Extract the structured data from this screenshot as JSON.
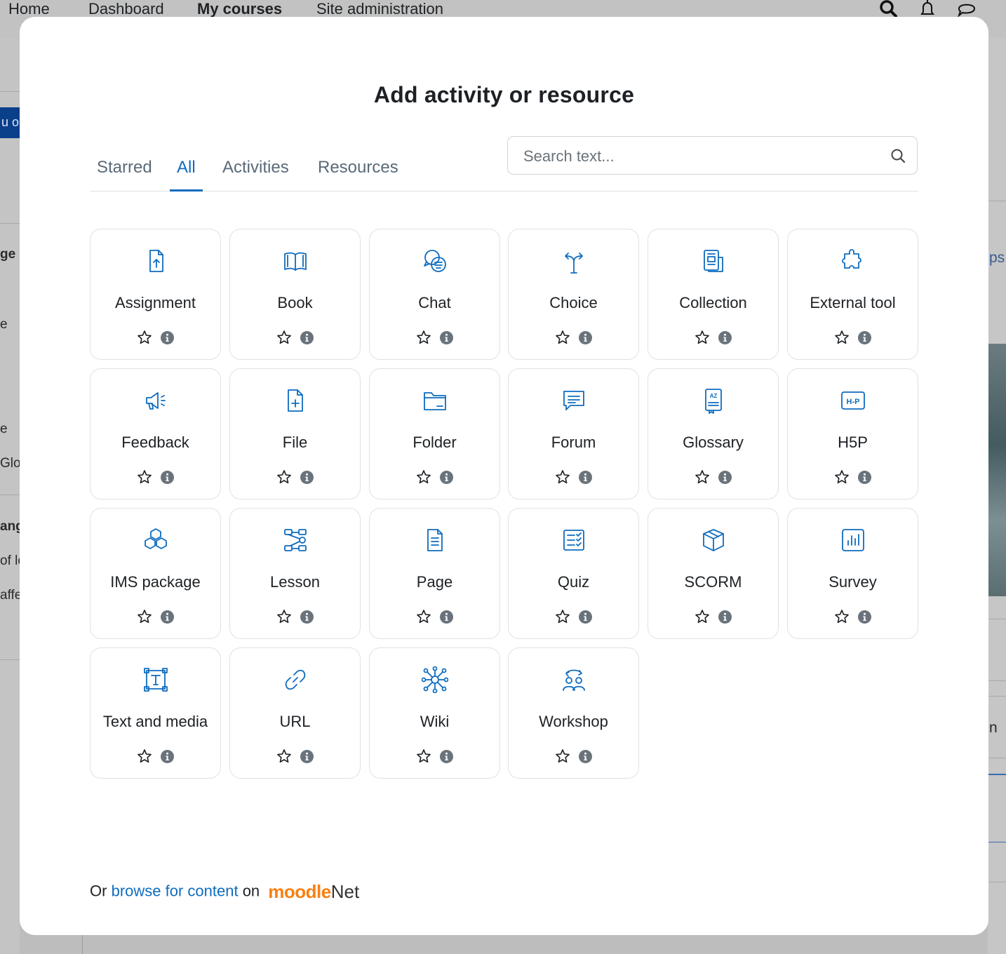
{
  "topnav": {
    "items": [
      "Home",
      "Dashboard",
      "My courses",
      "Site administration"
    ],
    "active_index": 2,
    "icons": [
      "search-icon",
      "bell-icon",
      "chat-icon"
    ]
  },
  "background_fragments": [
    "u ou",
    "ge",
    "e",
    "e",
    "Glol",
    "ang",
    "of lo",
    "affe",
    "ps",
    "n"
  ],
  "modal": {
    "title": "Add activity or resource",
    "tabs": [
      "Starred",
      "All",
      "Activities",
      "Resources"
    ],
    "active_tab": "All",
    "search_placeholder": "Search text...",
    "items": [
      {
        "label": "Assignment",
        "icon": "assignment-icon"
      },
      {
        "label": "Book",
        "icon": "book-icon"
      },
      {
        "label": "Chat",
        "icon": "chat-icon"
      },
      {
        "label": "Choice",
        "icon": "choice-icon"
      },
      {
        "label": "Collection",
        "icon": "collection-icon"
      },
      {
        "label": "External tool",
        "icon": "external-tool-icon"
      },
      {
        "label": "Feedback",
        "icon": "feedback-icon"
      },
      {
        "label": "File",
        "icon": "file-icon"
      },
      {
        "label": "Folder",
        "icon": "folder-icon"
      },
      {
        "label": "Forum",
        "icon": "forum-icon"
      },
      {
        "label": "Glossary",
        "icon": "glossary-icon"
      },
      {
        "label": "H5P",
        "icon": "h5p-icon"
      },
      {
        "label": "IMS package",
        "icon": "ims-package-icon"
      },
      {
        "label": "Lesson",
        "icon": "lesson-icon"
      },
      {
        "label": "Page",
        "icon": "page-icon"
      },
      {
        "label": "Quiz",
        "icon": "quiz-icon"
      },
      {
        "label": "SCORM",
        "icon": "scorm-icon"
      },
      {
        "label": "Survey",
        "icon": "survey-icon"
      },
      {
        "label": "Text and media",
        "icon": "text-media-icon"
      },
      {
        "label": "URL",
        "icon": "url-icon"
      },
      {
        "label": "Wiki",
        "icon": "wiki-icon"
      },
      {
        "label": "Workshop",
        "icon": "workshop-icon"
      }
    ],
    "footer": {
      "prefix": "Or",
      "link": "browse for content",
      "suffix": "on",
      "logo_part1": "moodle",
      "logo_part2": "Net"
    }
  },
  "colors": {
    "accent": "#0f6cbf",
    "icon": "#0f6cbf",
    "logo_orange": "#f98012"
  }
}
